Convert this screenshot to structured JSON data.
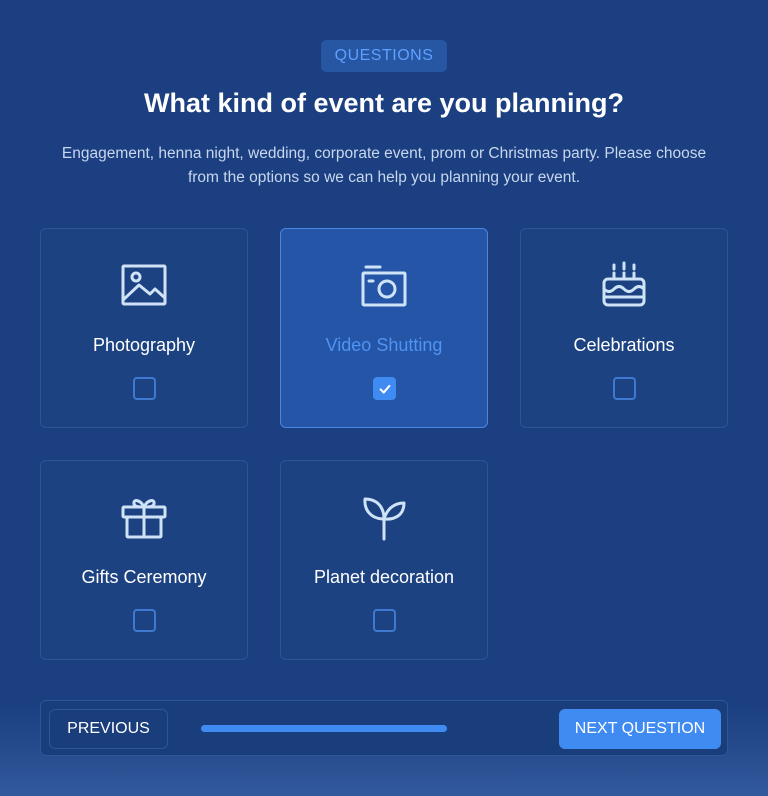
{
  "header": {
    "badge": "QUESTIONS",
    "title": "What kind of event are you planning?",
    "subtitle": "Engagement, henna night, wedding, corporate event, prom or Christmas party. Please choose from the options so we can help you planning your event."
  },
  "options": [
    {
      "label": "Photography",
      "icon": "image-icon",
      "checked": false
    },
    {
      "label": "Video Shutting",
      "icon": "camera-icon",
      "checked": true
    },
    {
      "label": "Celebrations",
      "icon": "cake-icon",
      "checked": false
    },
    {
      "label": "Gifts Ceremony",
      "icon": "gift-icon",
      "checked": false
    },
    {
      "label": "Planet decoration",
      "icon": "plant-icon",
      "checked": false
    }
  ],
  "footer": {
    "previous_label": "PREVIOUS",
    "next_label": "NEXT QUESTION",
    "progress": 1.0
  },
  "colors": {
    "background": "#1b3f80",
    "accent": "#3f8bf2",
    "icon": "#cfe3f7"
  }
}
